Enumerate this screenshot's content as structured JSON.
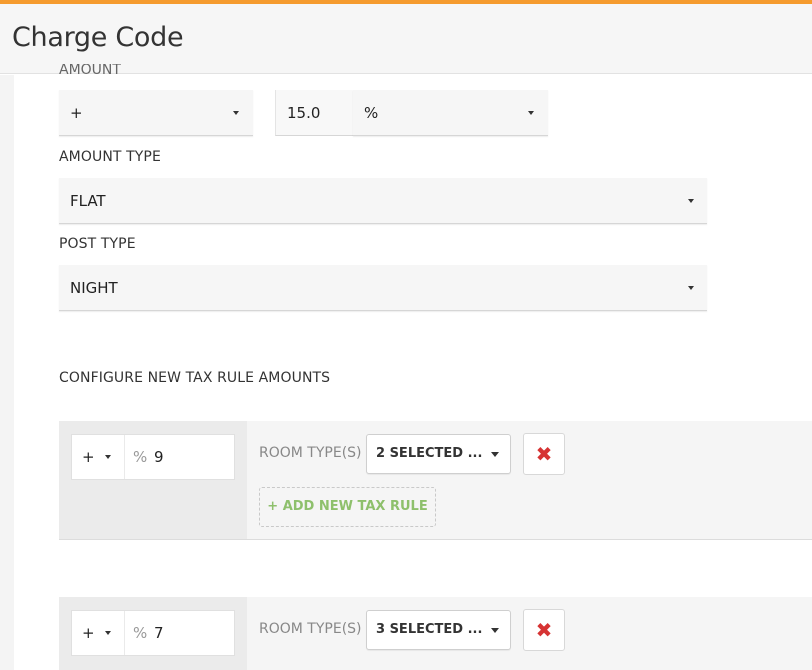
{
  "header": {
    "title": "Charge Code"
  },
  "form": {
    "amount_label_partial": "AMOUNT",
    "amount": {
      "sign": "+",
      "value": "15.0",
      "unit": "%"
    },
    "amount_type": {
      "label": "AMOUNT TYPE",
      "value": "FLAT"
    },
    "post_type": {
      "label": "POST TYPE",
      "value": "NIGHT"
    }
  },
  "tax_rules": {
    "heading": "CONFIGURE NEW TAX RULE AMOUNTS",
    "room_type_label": "ROOM TYPE(S)",
    "add_label": "+ ADD NEW TAX RULE",
    "delete_icon": "✖",
    "rules": [
      {
        "sign": "+",
        "unit": "%",
        "value": "9",
        "room_types": "2 SELECTED ..."
      },
      {
        "sign": "+",
        "unit": "%",
        "value": "7",
        "room_types": "3 SELECTED ..."
      }
    ]
  },
  "colors": {
    "accent": "#f59b2e",
    "delete": "#d63333",
    "add": "#8ec06c"
  }
}
